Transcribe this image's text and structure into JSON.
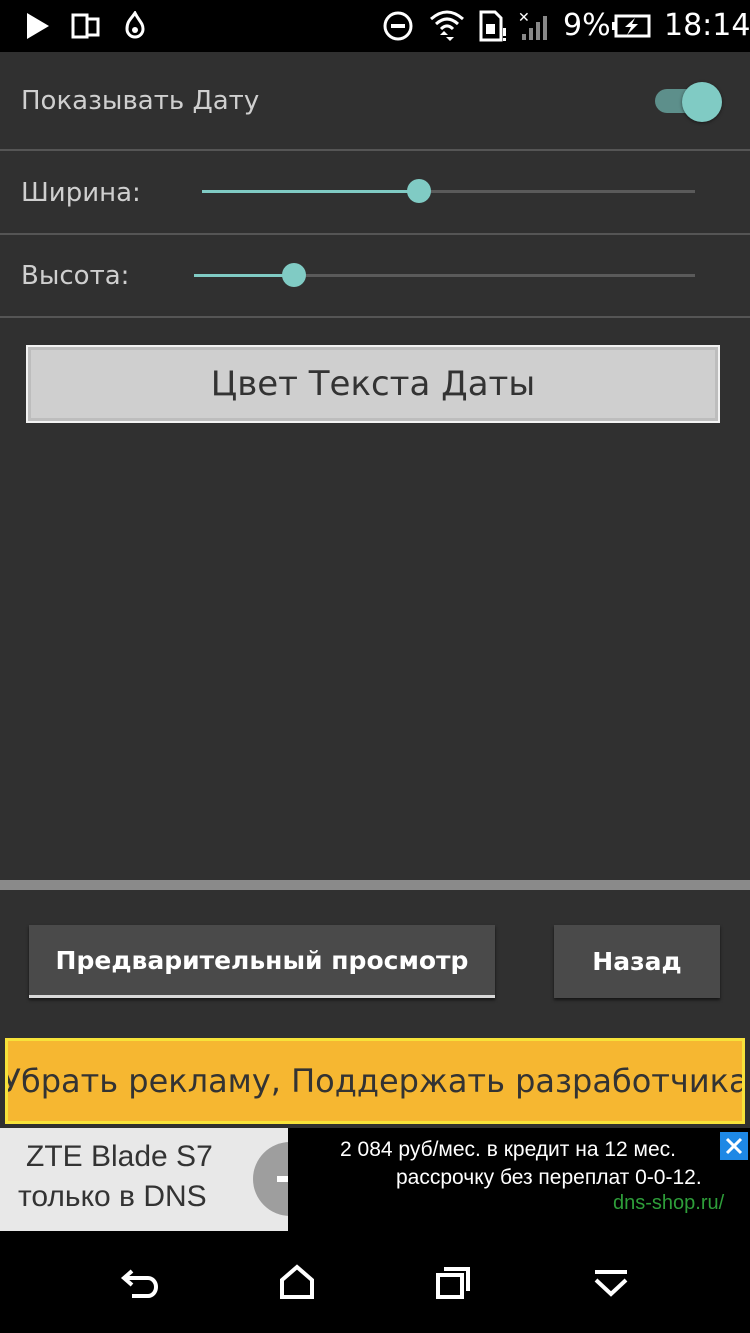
{
  "status_bar": {
    "battery_percent": "9%",
    "time": "18:14",
    "icons": [
      "play-icon",
      "dual-screen-icon",
      "fire-icon",
      "do-not-disturb-icon",
      "wifi-icon",
      "sim-icon",
      "signal-icon",
      "battery-charging-icon"
    ]
  },
  "settings": {
    "show_date_label": "Показывать Дату",
    "show_date_enabled": true,
    "width_label": "Ширина:",
    "width_value": 0.44,
    "height_label": "Высота:",
    "height_value": 0.2
  },
  "color_button_label": "Цвет Текста Даты",
  "buttons": {
    "preview_label": "Предварительный просмотр",
    "back_label": "Назад"
  },
  "remove_ads_label": "Убрать рекламу, Поддержать разработчика",
  "ad": {
    "title_line1": "ZTE Blade S7",
    "title_line2": "только в DNS",
    "desc_line1": "2 084 руб/мес. в кредит на 12 мес.",
    "desc_line2": "рассрочку без переплат 0-0-12.",
    "url": "dns-shop.ru/"
  },
  "nav_icons": [
    "back-icon",
    "home-icon",
    "recents-icon",
    "hide-keyboard-icon"
  ],
  "colors": {
    "accent": "#80cbc4",
    "background": "#303030",
    "ad_yellow": "#f6b731",
    "ad_url_green": "#2e9e3a"
  }
}
